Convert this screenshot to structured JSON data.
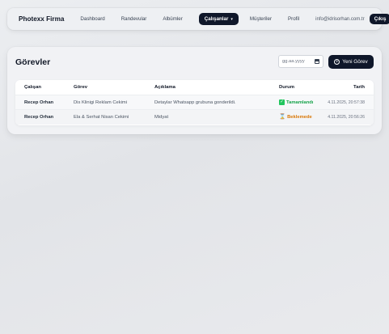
{
  "nav": {
    "brand": "Photexx Firma",
    "links": [
      "Dashboard",
      "Randevular",
      "Albümler"
    ],
    "active": "Çalışanlar",
    "links_after": [
      "Müşteriler",
      "Profil"
    ],
    "email": "info@idrisorhan.com.tr",
    "logout": "Çıkış"
  },
  "page": {
    "title": "Görevler",
    "date_placeholder": "gg.aa.yyyy",
    "new_button": "Yeni Görev"
  },
  "table": {
    "headers": [
      "Çalışan",
      "Görev",
      "Açıklama",
      "Durum",
      "Tarih"
    ],
    "rows": [
      {
        "worker": "Recep Orhan",
        "task": "Dis Klinigi Reklam Cekimi",
        "description": "Detaylar Whatsapp grubuna gonderildi.",
        "status": "Tamamlandı",
        "status_icon": "check-icon",
        "date": "4.11.2025, 20:57:38"
      },
      {
        "worker": "Recep Orhan",
        "task": "Ela & Serhat Nisan Cekimi",
        "description": "Midyat",
        "status": "Beklemede",
        "status_icon": "hourglass-icon",
        "date": "4.11.2025, 20:56:26"
      }
    ]
  },
  "colors": {
    "primary_dark": "#0f172a",
    "status_done": "#16a34a",
    "status_wait": "#d97706"
  }
}
